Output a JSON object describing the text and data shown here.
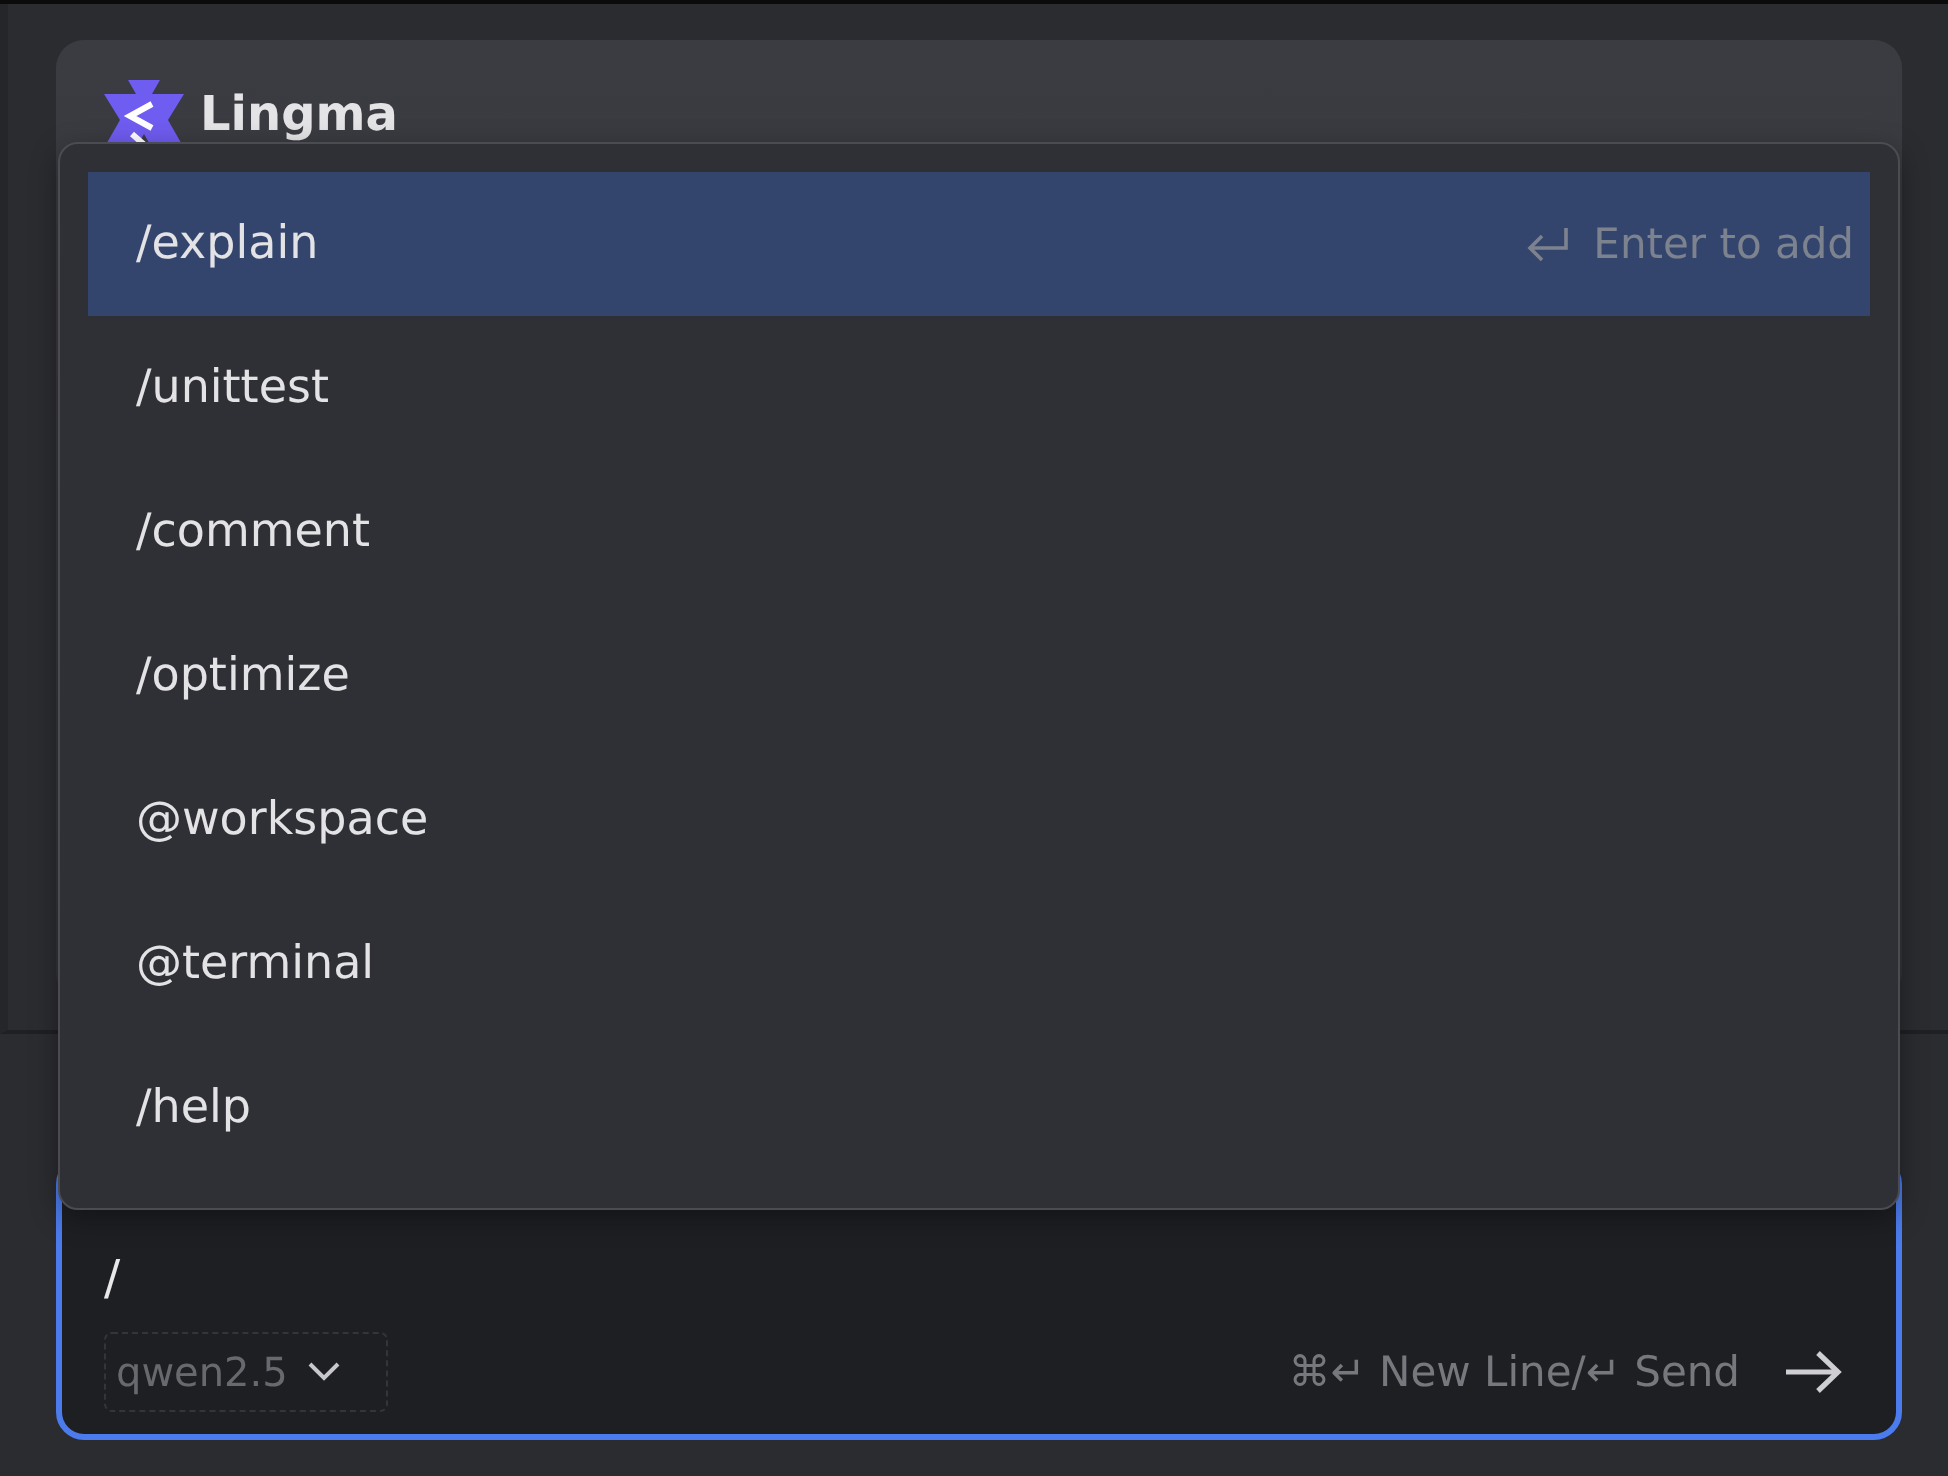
{
  "header": {
    "logo_text": "Lingma"
  },
  "dropdown": {
    "items": [
      {
        "label": "/explain",
        "selected": true,
        "hint": "Enter to add"
      },
      {
        "label": "/unittest",
        "selected": false
      },
      {
        "label": "/comment",
        "selected": false
      },
      {
        "label": "/optimize",
        "selected": false
      },
      {
        "label": "@workspace",
        "selected": false
      },
      {
        "label": "@terminal",
        "selected": false
      },
      {
        "label": "/help",
        "selected": false
      }
    ]
  },
  "composer": {
    "value": "/",
    "model": "qwen2.5",
    "shortcut_hint": "⌘↵ New Line/↵ Send"
  }
}
